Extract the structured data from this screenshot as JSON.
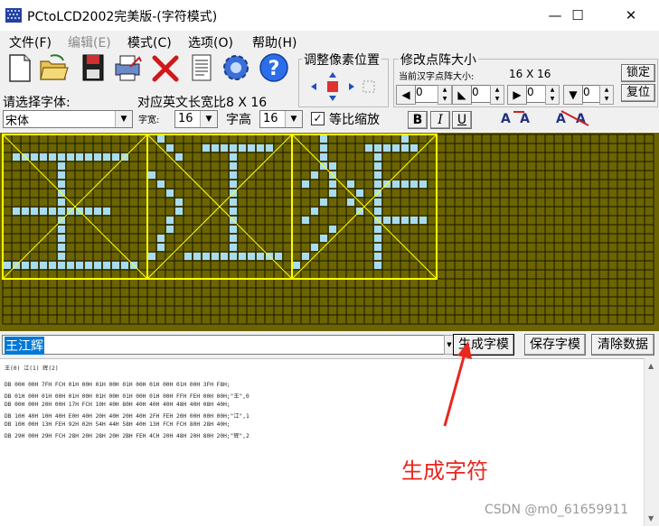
{
  "window": {
    "title": "PCtoLCD2002完美版-(字符模式)",
    "minimize": "—",
    "maximize": "☐",
    "close": "✕"
  },
  "menu": [
    {
      "label": "文件(F)",
      "disabled": false
    },
    {
      "label": "编辑(E)",
      "disabled": true
    },
    {
      "label": "模式(C)",
      "disabled": false
    },
    {
      "label": "选项(O)",
      "disabled": false
    },
    {
      "label": "帮助(H)",
      "disabled": false
    }
  ],
  "toolbar": {
    "icons": [
      "new-file-icon",
      "open-folder-icon",
      "save-disk-icon",
      "print-icon",
      "delete-x-icon",
      "notepad-icon",
      "settings-gear-icon",
      "help-question-icon"
    ]
  },
  "pixel_adjust": {
    "title": "调整像素位置"
  },
  "matrix_size": {
    "title": "修改点阵大小",
    "current_label": "当前汉字点阵大小:",
    "current_value": "16 X 16",
    "lock_button": "锁定",
    "reset_button": "复位",
    "spins": [
      "0",
      "0",
      "0",
      "0"
    ]
  },
  "font_select": {
    "label": "请选择字体:",
    "value": "宋体",
    "ratio_label": "对应英文长宽比8 X 16"
  },
  "font_size": {
    "width_label": "字宽:",
    "width_value": "16",
    "height_label": "字高",
    "height_value": "16",
    "proportional_label": "等比缩放",
    "proportional_checked": "✓"
  },
  "style_buttons": {
    "bold": "B",
    "italic": "I",
    "underline": "U"
  },
  "grid": {
    "bg_color": "#6b6400",
    "pixel_on_color": "#a8dcf0",
    "guide_color": "#ffff00",
    "glyphs": [
      [
        "................",
        "................",
        ".#############..",
        "......#.........",
        "......#.........",
        "......#.........",
        "......#.........",
        "......#.........",
        ".###########....",
        "......#.........",
        "......#.........",
        "......#.........",
        "......#.........",
        "......#.........",
        "###############.",
        "................"
      ],
      [
        ".#..............",
        "..#...########..",
        "...#.....#......",
        ".........#......",
        "#........#......",
        ".#.......#......",
        "..#......#......",
        "...#.....#......",
        "...#.....#......",
        "..#......#......",
        "..#......#......",
        ".#.......#......",
        ".#.......#......",
        "#...###########.",
        "................",
        "................"
      ],
      [
        "...#........#...",
        "...#....######..",
        "...#.....#......",
        "...##....#......",
        "..#.#....#......",
        ".#..#.#..######.",
        "....#..#.#......",
        "...#..#..#......",
        "..#....#.#......",
        ".#.......######.",
        "....#....#......",
        "...#.....#......",
        "..#......#......",
        ".#.......#......",
        "#........#......",
        "................"
      ]
    ]
  },
  "input": {
    "text": "王江辉",
    "generate_button": "生成字模",
    "save_button": "保存字模",
    "clear_button": "清除数据"
  },
  "output": {
    "lines": [
      "王(0) 江(1) 辉(2)",
      "",
      "DB 00H 00H 7FH FCH 01H 00H 01H 00H 01H 00H 01H 00H 01H 00H 3FH F8H;",
      "DB 01H 00H 01H 00H 01H 00H 01H 00H 01H 00H 01H 00H FFH FEH 00H 00H;\"王\",0",
      "DB 00H 00H 20H 00H 17H FCH 10H 40H 80H 40H 40H 40H 48H 40H 08H 40H;",
      "DB 10H 40H 10H 40H E0H 40H 20H 40H 20H 40H 2FH FEH 20H 00H 00H 00H;\"江\",1",
      "DB 10H 00H 13H FEH 92H 02H 54H 44H 58H 40H 13H FCH FCH 80H 28H 40H;",
      "DB 29H 00H 29H FCH 28H 20H 28H 20H 2BH FEH 4CH 20H 48H 20H 80H 20H;\"辉\",2"
    ]
  },
  "annotation": {
    "text": "生成字符",
    "color": "#e8271f"
  },
  "watermark": "CSDN @m0_61659911"
}
